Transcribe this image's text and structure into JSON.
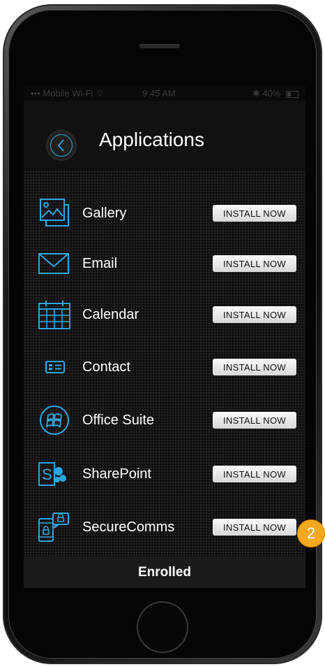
{
  "status_bar": {
    "carrier": "Mobile Wi-Fi",
    "time": "9:45 AM",
    "battery": "40%"
  },
  "header": {
    "title": "Applications",
    "back_icon": "chevron-left-icon"
  },
  "apps": [
    {
      "label": "Gallery",
      "icon": "gallery-icon",
      "button": "INSTALL NOW"
    },
    {
      "label": "Email",
      "icon": "email-icon",
      "button": "INSTALL NOW"
    },
    {
      "label": "Calendar",
      "icon": "calendar-icon",
      "button": "INSTALL NOW"
    },
    {
      "label": "Contact",
      "icon": "contact-icon",
      "button": "INSTALL NOW"
    },
    {
      "label": "Office Suite",
      "icon": "office-suite-icon",
      "button": "INSTALL NOW"
    },
    {
      "label": "SharePoint",
      "icon": "sharepoint-icon",
      "button": "INSTALL NOW"
    },
    {
      "label": "SecureComms",
      "icon": "securecomms-icon",
      "button": "INSTALL NOW"
    }
  ],
  "footer": {
    "status": "Enrolled"
  },
  "callout": {
    "number": "2"
  },
  "colors": {
    "accent": "#2da7e0",
    "callout": "#f4a81e",
    "background": "#0a0a0a"
  }
}
